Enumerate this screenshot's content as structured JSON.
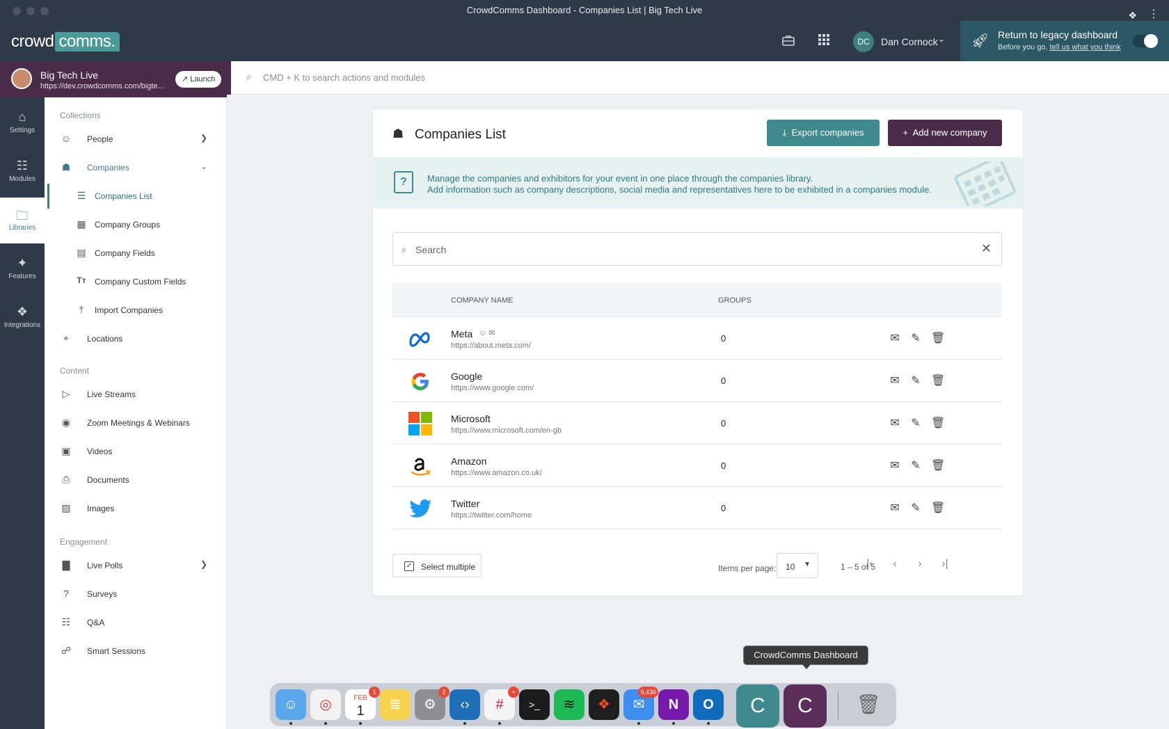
{
  "window": {
    "title": "CrowdComms Dashboard - Companies List | Big Tech Live"
  },
  "appbar": {
    "logo_text": "crowd",
    "logo_dot": "comms.",
    "user_initials": "DC",
    "user_name": "Dan Cornock",
    "legacy_title": "Return to legacy dashboard",
    "legacy_sub": "Before you go, ",
    "legacy_link": "tell us what you think"
  },
  "event": {
    "name": "Big Tech Live",
    "url": "https://dev.crowdcomms.com/bigtechlive",
    "launch_label": "Launch"
  },
  "global_search": {
    "placeholder": "CMD + K to search actions and modules"
  },
  "rail": [
    {
      "label": "Settings",
      "icon": "home-icon"
    },
    {
      "label": "Modules",
      "icon": "grid-icon"
    },
    {
      "label": "Libraries",
      "icon": "folder-icon"
    },
    {
      "label": "Features",
      "icon": "sparkle-icon"
    },
    {
      "label": "Integrations",
      "icon": "puzzle-icon"
    }
  ],
  "nav": {
    "sections": [
      "Collections",
      "Content",
      "Engagement"
    ],
    "items": [
      {
        "label": "People"
      },
      {
        "label": "Companies"
      },
      {
        "label": "Companies List"
      },
      {
        "label": "Company Groups"
      },
      {
        "label": "Company Fields"
      },
      {
        "label": "Company Custom Fields"
      },
      {
        "label": "Import Companies"
      },
      {
        "label": "Locations"
      },
      {
        "label": "Live Streams"
      },
      {
        "label": "Zoom Meetings & Webinars"
      },
      {
        "label": "Videos"
      },
      {
        "label": "Documents"
      },
      {
        "label": "Images"
      },
      {
        "label": "Live Polls"
      },
      {
        "label": "Surveys"
      },
      {
        "label": "Q&A"
      },
      {
        "label": "Smart Sessions"
      }
    ]
  },
  "card": {
    "title": "Companies List",
    "export_label": "Export companies",
    "add_label": "Add new company",
    "info_line1": "Manage the companies and exhibitors for your event in one place through the companies library.",
    "info_line2": "Add information such as company descriptions, social media and representatives here to be exhibited in a companies module.",
    "search_placeholder": "Search"
  },
  "table": {
    "headers": {
      "name": "COMPANY NAME",
      "groups": "GROUPS"
    },
    "rows": [
      {
        "name": "Meta",
        "url": "https://about.meta.com/",
        "groups": "0",
        "logo": "meta-logo"
      },
      {
        "name": "Google",
        "url": "https://www.google.com/",
        "groups": "0",
        "logo": "google-logo"
      },
      {
        "name": "Microsoft",
        "url": "https://www.microsoft.com/en-gb",
        "groups": "0",
        "logo": "microsoft-logo"
      },
      {
        "name": "Amazon",
        "url": "https://www.amazon.co.uk/",
        "groups": "0",
        "logo": "amazon-logo"
      },
      {
        "name": "Twitter",
        "url": "https://twitter.com/home",
        "groups": "0",
        "logo": "twitter-logo"
      }
    ]
  },
  "footer": {
    "select_multiple": "Select multiple",
    "items_per_page_label": "Items per page:",
    "items_per_page": "10",
    "range": "1 – 5 of 5"
  },
  "dock": {
    "tooltip": "CrowdComms Dashboard",
    "calendar_month": "FEB",
    "calendar_day": "1",
    "badges": {
      "calendar": "1",
      "settings": "2",
      "mail": "9,436"
    }
  },
  "colors": {
    "accent_teal": "#3e8a8c",
    "brand_purple": "#4a2c48",
    "topbar": "#2e3a48"
  }
}
